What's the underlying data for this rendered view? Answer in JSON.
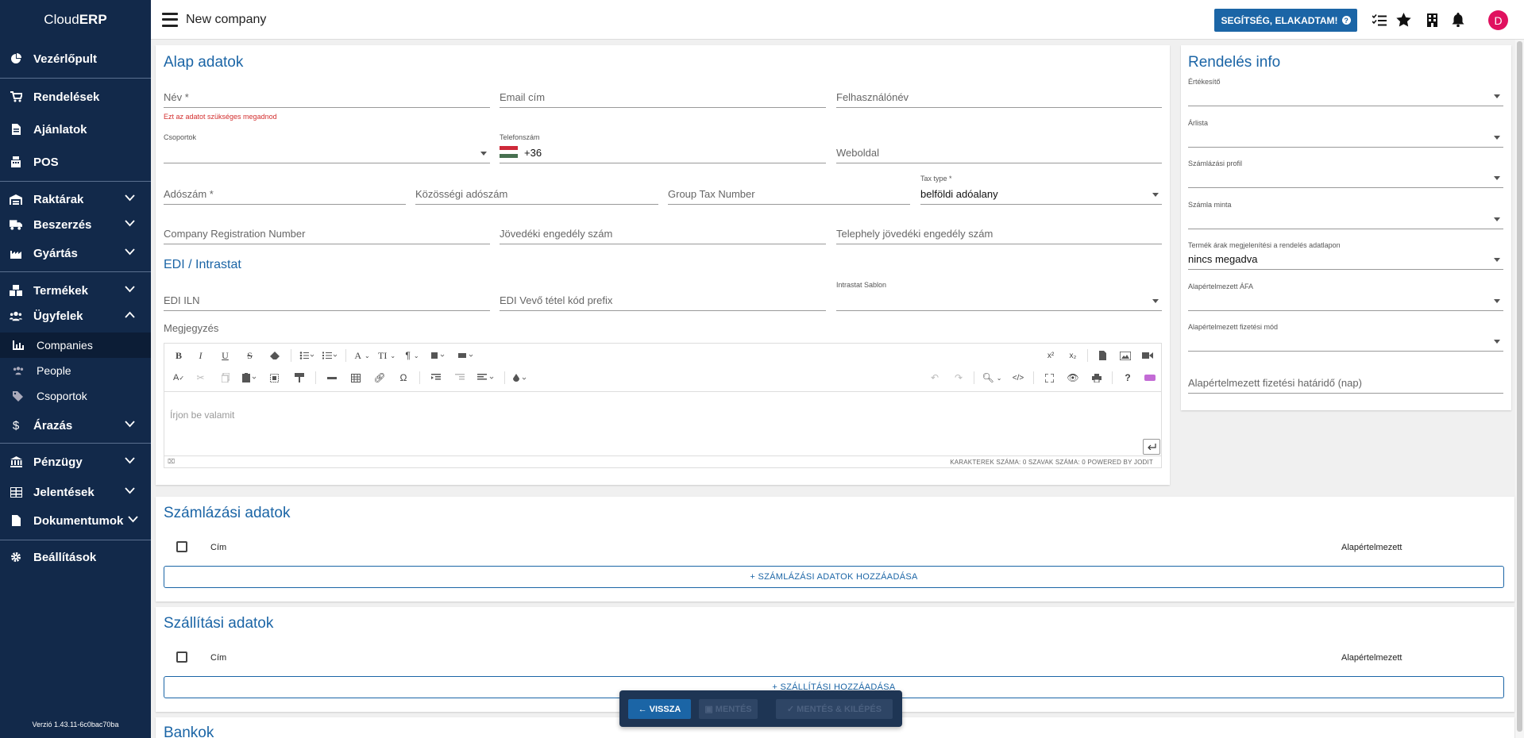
{
  "app": {
    "brand_prefix": "Cloud",
    "brand_bold": "ERP",
    "version": "Verzió 1.43.11-6c0bac70ba"
  },
  "sidebar": {
    "items": [
      {
        "label": "Vezérlőpult",
        "icon": "chart-pie-icon"
      },
      {
        "label": "Rendelések",
        "icon": "cart-icon"
      },
      {
        "label": "Ajánlatok",
        "icon": "document-icon"
      },
      {
        "label": "POS",
        "icon": "cash-register-icon"
      },
      {
        "label": "Raktárak",
        "icon": "warehouse-icon"
      },
      {
        "label": "Beszerzés",
        "icon": "truck-icon"
      },
      {
        "label": "Gyártás",
        "icon": "factory-icon"
      },
      {
        "label": "Termékek",
        "icon": "boxes-icon"
      },
      {
        "label": "Ügyfelek",
        "icon": "users-icon"
      },
      {
        "label": "Árazás",
        "icon": "dollar-icon"
      },
      {
        "label": "Pénzügy",
        "icon": "bank-icon"
      },
      {
        "label": "Jelentések",
        "icon": "table-icon"
      },
      {
        "label": "Dokumentumok",
        "icon": "file-icon"
      },
      {
        "label": "Beállítások",
        "icon": "gear-icon"
      }
    ],
    "sub_items": [
      {
        "label": "Companies",
        "icon": "chart-bar-icon"
      },
      {
        "label": "People",
        "icon": "people-icon"
      },
      {
        "label": "Csoportok",
        "icon": "tags-icon"
      }
    ]
  },
  "header": {
    "title": "New company",
    "help_button": "SEGÍTSÉG, ELAKADTAM!",
    "avatar_letter": "D"
  },
  "alap": {
    "title": "Alap adatok",
    "name_placeholder": "Név *",
    "name_error": "Ezt az adatot szükséges megadnod",
    "email_placeholder": "Email cím",
    "username_placeholder": "Felhasználónév",
    "groups_label": "Csoportok",
    "phone_label": "Telefonszám",
    "phone_value": "+36",
    "website_placeholder": "Weboldal",
    "tax_placeholder": "Adószám *",
    "eu_tax_placeholder": "Közösségi adószám",
    "group_tax_placeholder": "Group Tax Number",
    "tax_type_label": "Tax type *",
    "tax_type_value": "belföldi adóalany",
    "company_reg_placeholder": "Company Registration Number",
    "excise_placeholder": "Jövedéki engedély szám",
    "site_excise_placeholder": "Telephely jövedéki engedély szám",
    "edi_title": "EDI / Intrastat",
    "edi_iln_placeholder": "EDI ILN",
    "edi_prefix_placeholder": "EDI Vevő tétel kód prefix",
    "intrastat_label": "Intrastat Sablon",
    "note_label": "Megjegyzés",
    "editor_placeholder": "Írjon be valamit",
    "editor_status": "KARAKTEREK SZÁMA: 0   SZAVAK SZÁMA: 0   POWERED BY JODIT"
  },
  "rendeles": {
    "title": "Rendelés info",
    "salesperson_label": "Értékesítő",
    "pricelist_label": "Árlista",
    "billing_profile_label": "Számlázási profil",
    "invoice_template_label": "Számla minta",
    "price_display_label": "Termék árak megjelenítési a rendelés adatlapon",
    "price_display_value": "nincs megadva",
    "vat_label": "Alapértelmezett ÁFA",
    "payment_method_label": "Alapértelmezett fizetési mód",
    "payment_deadline_placeholder": "Alapértelmezett fizetési határidő (nap)"
  },
  "szamlazasi": {
    "title": "Számlázási adatok",
    "col_address": "Cím",
    "col_default": "Alapértelmezett",
    "add_button": "+ SZÁMLÁZÁSI ADATOK HOZZÁADÁSA"
  },
  "szallitasi": {
    "title": "Szállítási adatok",
    "col_address": "Cím",
    "col_default": "Alapértelmezett",
    "add_button": "+ SZÁLLÍTÁSI HOZZÁADÁSA"
  },
  "bankok": {
    "title": "Bankok"
  },
  "bottom_bar": {
    "back": "VISSZA",
    "save": "MENTÉS",
    "save_exit": "MENTÉS & KILÉPÉS"
  },
  "colors": {
    "sidebar": "#12294a",
    "accent": "#1b65a6",
    "error": "#d32f2f",
    "avatar": "#e0115f"
  }
}
